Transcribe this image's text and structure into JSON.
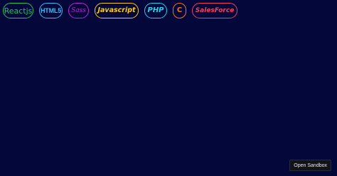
{
  "tags": [
    {
      "label": "Reactjs",
      "color": "#22c55e"
    },
    {
      "label": "HTML5",
      "color": "#38bdf8"
    },
    {
      "label": "Sass",
      "color": "#c026d3"
    },
    {
      "label": "Javascript",
      "color": "#facc15"
    },
    {
      "label": "PHP",
      "color": "#22d3ee"
    },
    {
      "label": "C",
      "color": "#f97316"
    },
    {
      "label": "SalesForce",
      "color": "#f43f5e"
    }
  ],
  "sandbox_button": {
    "label": "Open Sandbox"
  },
  "colors": {
    "background": "#03073a",
    "button_background": "#111318"
  }
}
